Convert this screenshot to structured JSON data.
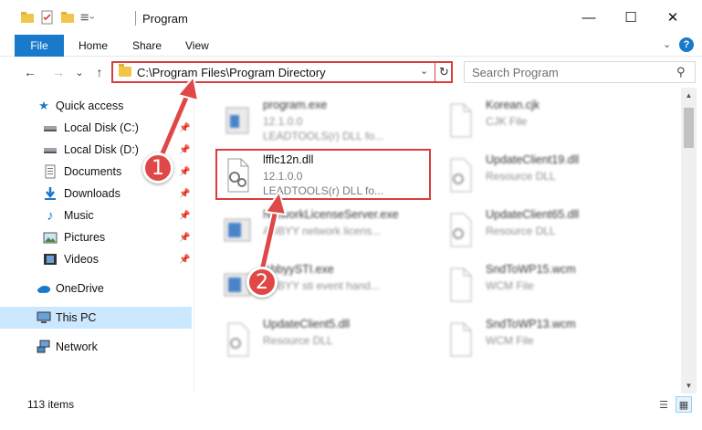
{
  "window": {
    "title": "Program",
    "minimize": "—",
    "maximize": "☐",
    "close": "✕"
  },
  "ribbon": {
    "tabs": [
      "File",
      "Home",
      "Share",
      "View"
    ],
    "expand": "⌄",
    "help": "?"
  },
  "nav": {
    "back": "←",
    "forward": "→",
    "recent": "⌄",
    "up": "↑",
    "address": "C:\\Program Files\\Program Directory",
    "address_dropdown": "⌄",
    "refresh": "↻",
    "search_placeholder": "Search Program",
    "search_icon": "⚲"
  },
  "sidebar": {
    "items": [
      {
        "label": "Quick access",
        "icon": "star-icon",
        "pinned": false
      },
      {
        "label": "Local Disk (C:)",
        "icon": "drive-icon",
        "pinned": true
      },
      {
        "label": "Local Disk (D:)",
        "icon": "drive-icon",
        "pinned": true
      },
      {
        "label": "Documents",
        "icon": "documents-icon",
        "pinned": true
      },
      {
        "label": "Downloads",
        "icon": "downloads-icon",
        "pinned": true
      },
      {
        "label": "Music",
        "icon": "music-icon",
        "pinned": true
      },
      {
        "label": "Pictures",
        "icon": "pictures-icon",
        "pinned": true
      },
      {
        "label": "Videos",
        "icon": "videos-icon",
        "pinned": true
      },
      {
        "label": "OneDrive",
        "icon": "cloud-icon",
        "pinned": false
      },
      {
        "label": "This PC",
        "icon": "computer-icon",
        "pinned": false,
        "selected": true
      },
      {
        "label": "Network",
        "icon": "network-icon",
        "pinned": false
      }
    ],
    "pin_glyph": "📌"
  },
  "files": [
    {
      "name": "program.exe",
      "line2": "12.1.0.0",
      "line3": "LEADTOOLS(r) DLL fo...",
      "icon": "exe-icon",
      "blurred": true
    },
    {
      "name": "Korean.cjk",
      "line2": "CJK File",
      "line3": "",
      "icon": "file-icon",
      "blurred": true
    },
    {
      "name": "lfflc12n.dll",
      "line2": "12.1.0.0",
      "line3": "LEADTOOLS(r) DLL fo...",
      "icon": "dll-icon",
      "blurred": false
    },
    {
      "name": "UpdateClient19.dll",
      "line2": "Resource DLL",
      "line3": "",
      "icon": "dll-icon",
      "blurred": true
    },
    {
      "name": "NetworkLicenseServer.exe",
      "line2": "ABBYY network licens...",
      "line3": "",
      "icon": "exe-icon",
      "blurred": true
    },
    {
      "name": "UpdateClient65.dll",
      "line2": "Resource DLL",
      "line3": "",
      "icon": "dll-icon",
      "blurred": true
    },
    {
      "name": "AbbyySTI.exe",
      "line2": "ABBYY sti event hand...",
      "line3": "",
      "icon": "exe-icon",
      "blurred": true
    },
    {
      "name": "SndToWP15.wcm",
      "line2": "WCM File",
      "line3": "",
      "icon": "file-icon",
      "blurred": true
    },
    {
      "name": "UpdateClient5.dll",
      "line2": "Resource DLL",
      "line3": "",
      "icon": "dll-icon",
      "blurred": true
    },
    {
      "name": "SndToWP13.wcm",
      "line2": "WCM File",
      "line3": "",
      "icon": "file-icon",
      "blurred": true
    }
  ],
  "status": {
    "items_count": "113 items"
  },
  "callouts": [
    "1",
    "2"
  ],
  "colors": {
    "accent": "#1979ca",
    "highlight": "#d93d3d",
    "selected": "#cce8ff"
  }
}
